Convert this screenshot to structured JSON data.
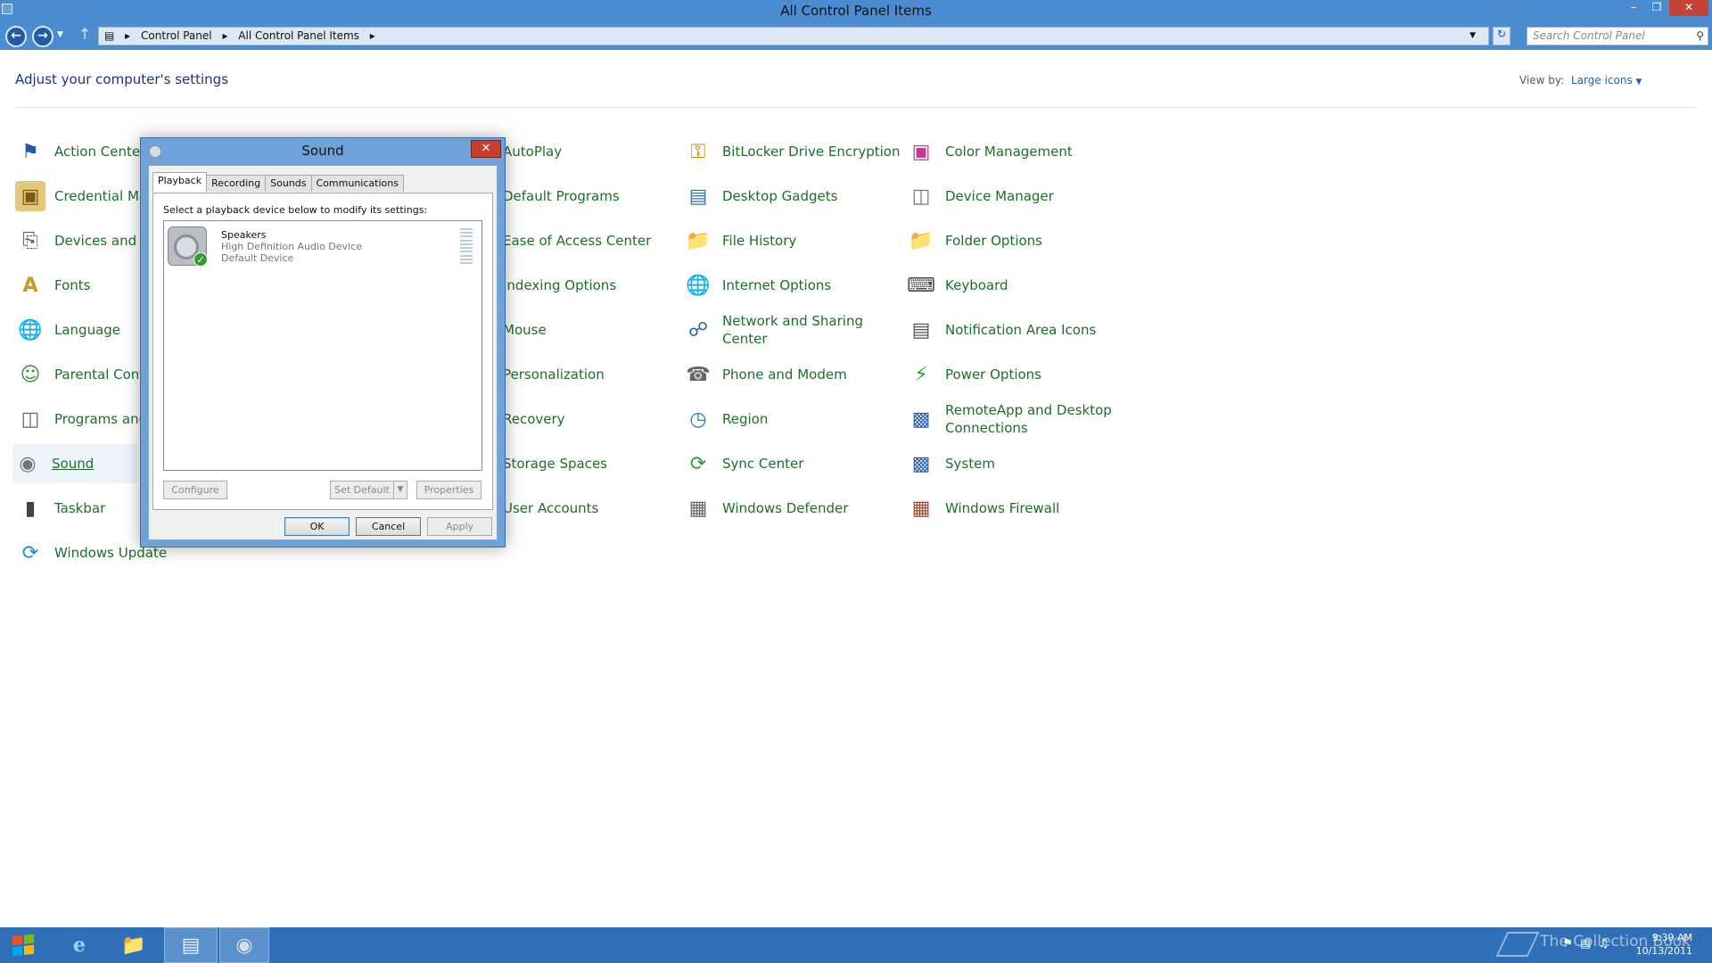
{
  "window": {
    "title": "All Control Panel Items"
  },
  "address": {
    "crumbs": [
      "Control Panel",
      "All Control Panel Items"
    ],
    "search_placeholder": "Search Control Panel"
  },
  "header": {
    "title": "Adjust your computer's settings",
    "view_by_label": "View by:",
    "view_by_value": "Large icons"
  },
  "items": {
    "col1": [
      "Action Center",
      "Credential Ma",
      "Devices and P",
      "Fonts",
      "Language",
      "Parental Cont",
      "Programs and",
      "Sound",
      "Taskbar",
      "Windows Update"
    ],
    "col2": [
      "AutoPlay",
      "Default Programs",
      "Ease of Access Center",
      "Indexing Options",
      "Mouse",
      "Personalization",
      "Recovery",
      "Storage Spaces",
      "User Accounts"
    ],
    "col3": [
      "BitLocker Drive Encryption",
      "Desktop Gadgets",
      "File History",
      "Internet Options",
      "Network and Sharing Center",
      "Phone and Modem",
      "Region",
      "Sync Center",
      "Windows Defender"
    ],
    "col4": [
      "Color Management",
      "Device Manager",
      "Folder Options",
      "Keyboard",
      "Notification Area Icons",
      "Power Options",
      "RemoteApp and Desktop Connections",
      "System",
      "Windows Firewall"
    ]
  },
  "dialog": {
    "title": "Sound",
    "tabs": [
      "Playback",
      "Recording",
      "Sounds",
      "Communications"
    ],
    "instruction": "Select a playback device below to modify its settings:",
    "device": {
      "name": "Speakers",
      "driver": "High Definition Audio Device",
      "status": "Default Device"
    },
    "buttons": {
      "configure": "Configure",
      "set_default": "Set Default",
      "properties": "Properties",
      "ok": "OK",
      "cancel": "Cancel",
      "apply": "Apply"
    }
  },
  "taskbar": {
    "time": "9:39 AM",
    "date": "10/13/2011",
    "watermark": "The Collection Book"
  },
  "colors": {
    "titlebar": "#4b8cd0",
    "taskbar": "#2f70b8",
    "link": "#1e6e2b",
    "heading": "#1e3287"
  }
}
